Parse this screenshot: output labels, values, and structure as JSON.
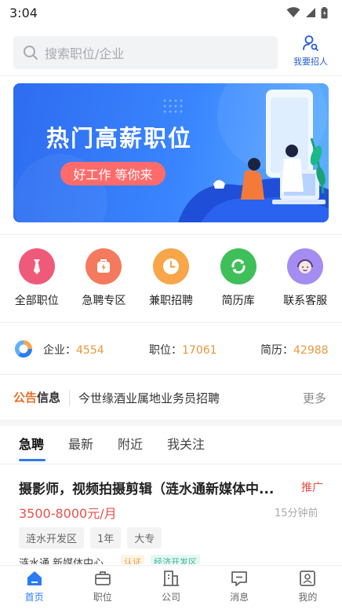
{
  "status_bar": {
    "time": "3:04"
  },
  "search": {
    "placeholder": "搜索职位/企业"
  },
  "header": {
    "recruit_label": "我要招人"
  },
  "banner": {
    "title": "热门高薪职位",
    "subtitle": "好工作 等你来"
  },
  "quick_entries": [
    {
      "label": "全部职位",
      "icon": "tie-icon",
      "color": "#f05a7a"
    },
    {
      "label": "急聘专区",
      "icon": "lightning-bag-icon",
      "color": "#f37a5c"
    },
    {
      "label": "兼职招聘",
      "icon": "clock-icon",
      "color": "#f7a64a"
    },
    {
      "label": "简历库",
      "icon": "resume-sync-icon",
      "color": "#3fbf5a"
    },
    {
      "label": "联系客服",
      "icon": "service-agent-icon",
      "color": "#a58cf0"
    }
  ],
  "stats": {
    "companies_label": "企业：",
    "companies_value": "4554",
    "jobs_label": "职位：",
    "jobs_value": "17061",
    "resumes_label": "简历：",
    "resumes_value": "42988"
  },
  "notice": {
    "brand_a": "公告",
    "brand_b": "信息",
    "text": "今世缘酒业属地业务员招聘",
    "more": "更多"
  },
  "tabs": [
    {
      "label": "急聘"
    },
    {
      "label": "最新"
    },
    {
      "label": "附近"
    },
    {
      "label": "我关注"
    }
  ],
  "job": {
    "title": "摄影师，视频拍摄剪辑（涟水通新媒体中...",
    "badge": "推广",
    "salary": "3500-8000元/月",
    "time": "15分钟前",
    "tags": [
      "涟水开发区",
      "1年",
      "大专"
    ],
    "company": "涟水通 新媒体中心",
    "company_tags": [
      "认证",
      "经济开发区"
    ]
  },
  "bottom_nav": [
    {
      "label": "首页",
      "icon": "home-icon",
      "active": true
    },
    {
      "label": "职位",
      "icon": "briefcase-icon",
      "active": false
    },
    {
      "label": "公司",
      "icon": "building-icon",
      "active": false
    },
    {
      "label": "消息",
      "icon": "message-icon",
      "active": false
    },
    {
      "label": "我的",
      "icon": "profile-icon",
      "active": false
    }
  ],
  "colors": {
    "accent": "#2a7bf5",
    "salary": "#e8524a",
    "stat_value": "#e6983b"
  }
}
